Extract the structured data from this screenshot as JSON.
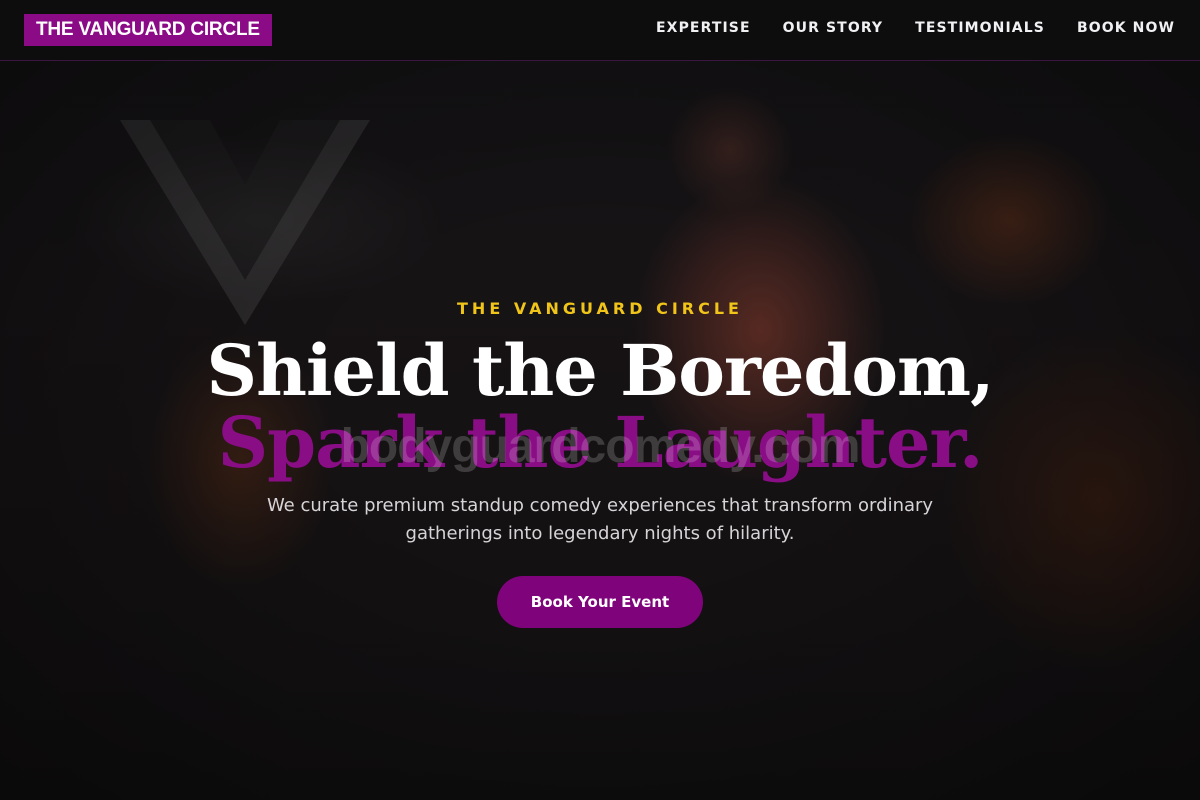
{
  "nav": {
    "brand": "THE VANGUARD CIRCLE",
    "links": [
      "EXPERTISE",
      "OUR STORY",
      "TESTIMONIALS",
      "BOOK NOW"
    ]
  },
  "hero": {
    "eyebrow": "THE VANGUARD CIRCLE",
    "headline_line_1": "Shield the Boredom,",
    "headline_line_2": "Spark the Laughter.",
    "watermark": "bodyguardcomedy.com",
    "subtitle": "We curate premium standup comedy experiences that transform ordinary gatherings into legendary nights of hilarity.",
    "cta_label": "Book Your Event"
  },
  "colors": {
    "brand_purple": "#8b0a86",
    "accent_gold": "#f0c419",
    "text_white": "#ffffff",
    "subtitle_text": "#d7d4d8",
    "nav_bg": "#0d0d0e"
  }
}
